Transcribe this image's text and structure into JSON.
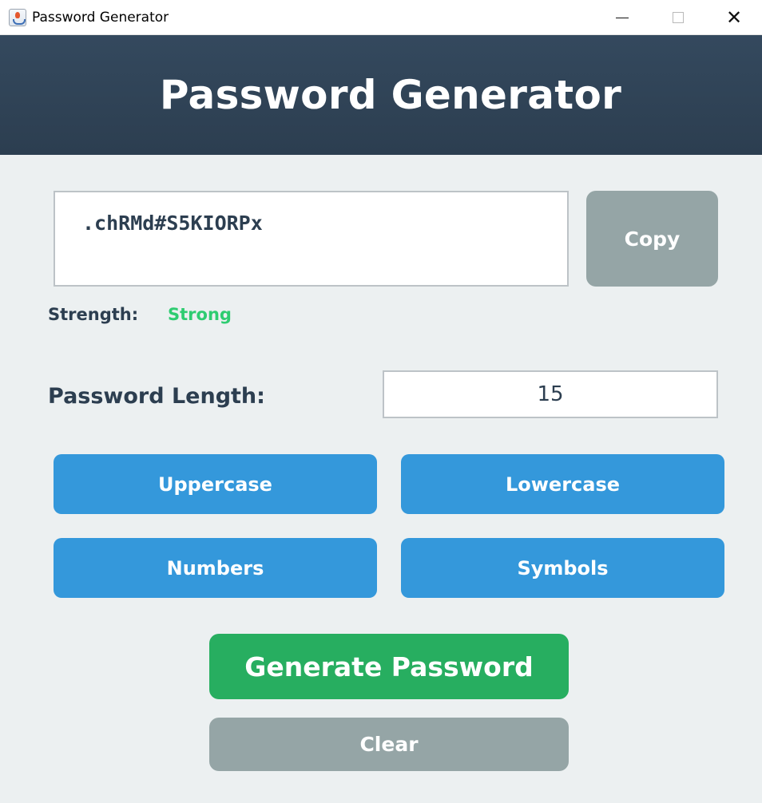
{
  "window": {
    "title": "Password Generator",
    "icon": "java-app-icon",
    "controls": {
      "minimize": "minimize-icon",
      "maximize": "maximize-icon",
      "close": "✕"
    }
  },
  "header": {
    "title": "Password Generator"
  },
  "password": {
    "value": ".chRMd#S5KIORPx"
  },
  "copy": {
    "label": "Copy"
  },
  "strength": {
    "label": "Strength:",
    "value": "Strong",
    "color": "#2ecc71"
  },
  "length": {
    "label": "Password Length:",
    "value": "15"
  },
  "options": [
    {
      "label": "Uppercase"
    },
    {
      "label": "Lowercase"
    },
    {
      "label": "Numbers"
    },
    {
      "label": "Symbols"
    }
  ],
  "actions": {
    "generate_label": "Generate Password",
    "clear_label": "Clear"
  },
  "colors": {
    "header": "#2c3e50",
    "option_button": "#3498db",
    "generate_button": "#27ae60",
    "neutral_button": "#95a5a6",
    "background": "#ecf0f1"
  }
}
